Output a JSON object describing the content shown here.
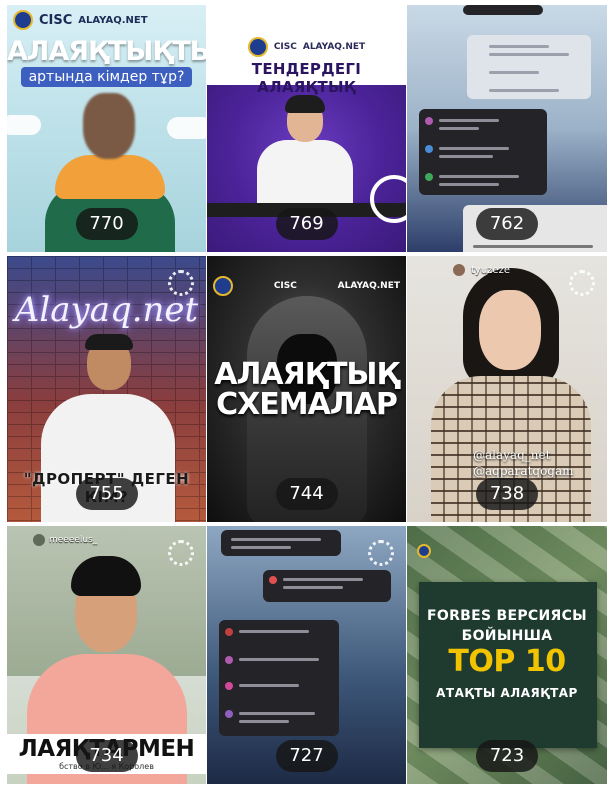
{
  "posts": [
    {
      "views": "770",
      "logo_text": "CISC",
      "logo_site": "ALAYAQ.NET",
      "headline": "АЛАЯҚТЫҚТЫҢ",
      "subtitle": "артында кімдер тұр?"
    },
    {
      "views": "769",
      "logo_text": "CISC",
      "logo_site": "ALAYAQ.NET",
      "headline": "ТЕНДЕРДЕГІ АЛАЯҚТЫҚ"
    },
    {
      "views": "762"
    },
    {
      "views": "755",
      "neon_text": "Alayaq.net",
      "bottom_text": "\"ДРОПЕРТ\" ДЕГЕН КІМ?"
    },
    {
      "views": "744",
      "logo_text": "CISC",
      "logo_site": "ALAYAQ.NET",
      "headline_line1": "АЛАЯҚТЫҚ",
      "headline_line2": "СХЕМАЛАР"
    },
    {
      "views": "738",
      "username": "tyuzeze",
      "watermark1": "@alayaq_net",
      "watermark2": "@aqparatqogam"
    },
    {
      "views": "734",
      "username": "meeeelus_",
      "banner_title": "ЛАЯҚТАРМЕН",
      "banner_sub": "бство в Ю... я Королев"
    },
    {
      "views": "727"
    },
    {
      "views": "723",
      "line1": "FORBES ВЕРСИЯСЫ",
      "line2": "БОЙЫНША",
      "line3": "TOP 10",
      "line4": "АТАҚТЫ АЛАЯҚТАР"
    }
  ],
  "colors": {
    "view_badge_bg": "#161616",
    "t2_purple": "#4b2398",
    "t9_gold": "#f2c400"
  }
}
